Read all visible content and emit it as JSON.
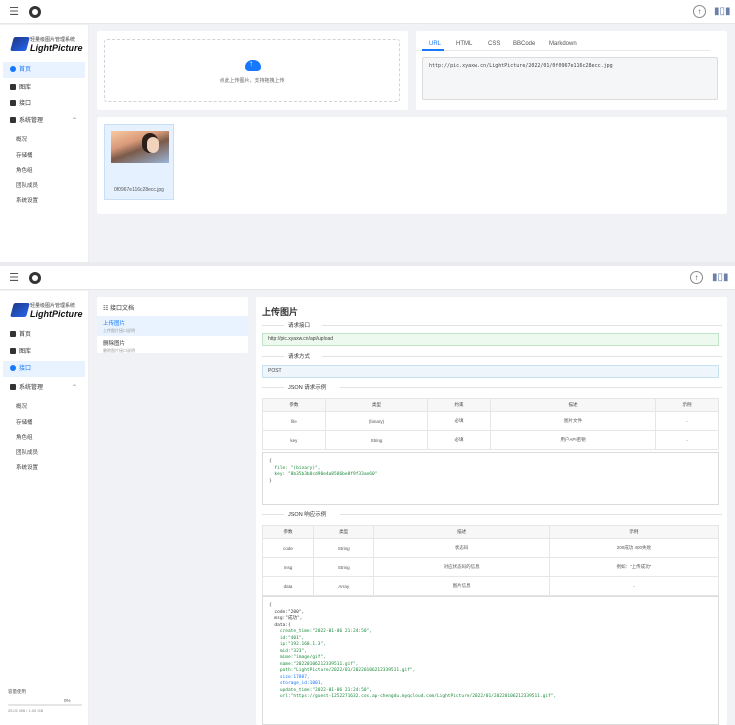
{
  "brand": {
    "subtitle": "轻量级图片管理系统",
    "name": "LightPicture"
  },
  "nav": {
    "home": "首页",
    "gallery": "图库",
    "api": "接口",
    "system": "系统管理",
    "sub_items": [
      "概况",
      "存储桶",
      "角色组",
      "团队成员",
      "系统设置"
    ]
  },
  "upload": {
    "hint": "点此上传图片，支持拖拽上传"
  },
  "link_tabs": [
    "URL",
    "HTML",
    "CSS",
    "BBCode",
    "Markdown"
  ],
  "link_url": "http://pic.xyaxw.cn/LightPicture/2022/01/0f0967e116c28ecc.jpg",
  "thumb": {
    "name": "0f0967e116c28ecc.jpg"
  },
  "docs": {
    "header": "接口文档",
    "items": [
      {
        "title": "上传图片",
        "sub": "上传图片接口说明"
      },
      {
        "title": "删除图片",
        "sub": "删除图片接口说明"
      }
    ]
  },
  "api": {
    "title": "上传图片",
    "sec_url": "请求接口",
    "url": "http://pic.xyaxw.cn/api/upload",
    "sec_method": "请求方式",
    "method": "POST",
    "sec_req": "JSON 请求示例",
    "req_headers": [
      "参数",
      "类型",
      "约束",
      "描述",
      "示例"
    ],
    "req_rows": [
      [
        "file",
        "(binary)",
        "必填",
        "图片文件",
        "-"
      ],
      [
        "key",
        "String",
        "必填",
        "用户API密钥",
        "-"
      ]
    ],
    "req_code": [
      "{",
      "  file: \"(binary)\",",
      "  key: \"8b35b3b8cd98e4a8586be8f9f33ae60\"",
      "}"
    ],
    "sec_res": "JSON 响应示例",
    "res_headers": [
      "参数",
      "类型",
      "描述",
      "示例"
    ],
    "res_rows": [
      [
        "code",
        "String",
        "状态码",
        "200成功 400失败"
      ],
      [
        "msg",
        "String",
        "对应状态码的信息",
        "例如：\"上传成功\""
      ],
      [
        "data",
        "Array",
        "图片信息",
        "-"
      ]
    ],
    "res_code": [
      "{",
      "  code:\"200\",",
      "  msg:\"成功\",",
      "  data:{",
      "    create_time:\"2022-01-06 21:24:50\",",
      "    id:\"401\",",
      "    ip:\"192.168.1.3\",",
      "    mid:\"323\",",
      "    mime:\"image/gif\",",
      "    name:\"20220106212339511.gif\",",
      "    path:\"LightPicture/2022/01/20220106212339511.gif\",",
      "    size:17887,",
      "    storage_id:1001,",
      "    update_time:\"2022-01-06 21:24:50\",",
      "    url:\"https://guest-1252271632.cos.ap-chengdu.myqcloud.com/LightPicture/2022/01/20220106212339511.gif\","
    ]
  },
  "storage": {
    "label": "容量使用",
    "percent": "0%",
    "percent_value": 0,
    "used": "25.01 MB / 1.00 GB"
  }
}
